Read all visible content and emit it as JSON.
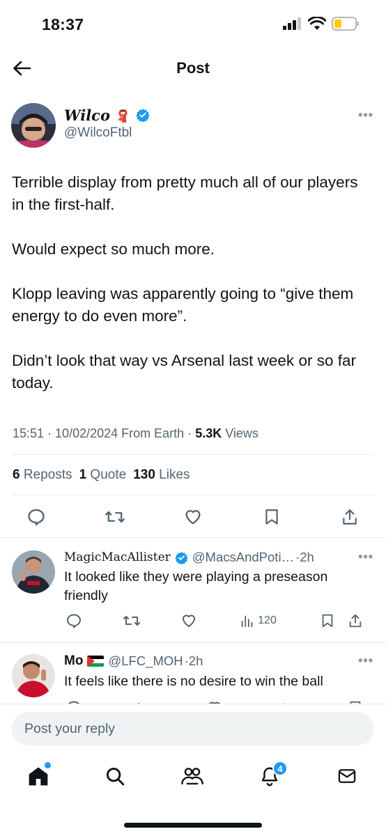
{
  "status_bar": {
    "time": "18:37"
  },
  "header": {
    "title": "Post",
    "back_icon": "arrow-left-icon"
  },
  "post": {
    "author": {
      "name": "Wilco",
      "flag_emoji": "🧣",
      "handle": "@WilcoFtbl",
      "verified": true
    },
    "paragraphs": [
      "Terrible display from pretty much all of our players in the first-half.",
      "Would expect so much more.",
      "Klopp leaving was apparently going to “give them energy to do even more”.",
      "Didn’t look that way vs Arsenal last week or so far today."
    ],
    "time": "15:51",
    "date": "10/02/2024",
    "source": "From Earth",
    "views_count": "5.3K",
    "views_label": "Views",
    "reposts_count": "6",
    "reposts_label": "Reposts",
    "quotes_count": "1",
    "quotes_label": "Quote",
    "likes_count": "130",
    "likes_label": "Likes"
  },
  "replies": [
    {
      "name": "MagicMacAllister",
      "handle": "@MacsAndPoti…",
      "age": "2h",
      "verified": true,
      "text": "It looked like they were playing a preseason friendly",
      "views": "120"
    },
    {
      "name": "Mo",
      "flag": "🇵🇸",
      "handle": "@LFC_MOH",
      "age": "2h",
      "text": "It feels like there is no desire to win the ball"
    }
  ],
  "reply_box": {
    "placeholder": "Post your reply"
  },
  "bottom_nav": {
    "notifications_badge": "4"
  },
  "colors": {
    "accent": "#1d9bf0",
    "text": "#0f1419",
    "secondary": "#536471"
  }
}
